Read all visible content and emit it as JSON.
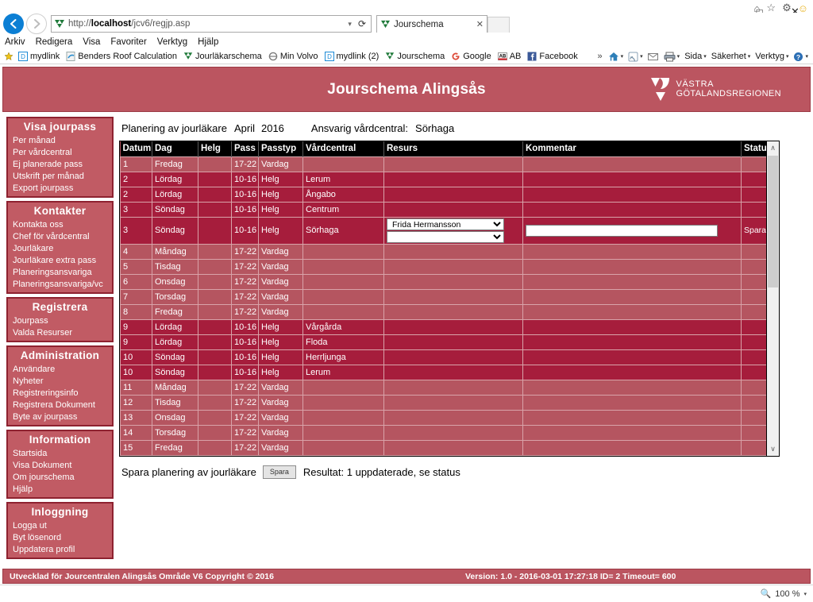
{
  "browser": {
    "window_controls": {
      "minimize": "–",
      "maximize": "□",
      "close": "✕"
    },
    "back_glyph": "←",
    "forward_glyph": "→",
    "address": {
      "url_prefix": "http://",
      "url_host": "localhost",
      "url_path": "/jcv6/regjp.asp",
      "dropdown_caret": "▾",
      "reload_glyph": "⟳"
    },
    "tab": {
      "title": "Jourschema",
      "close_glyph": "✕"
    },
    "chrome_icons": [
      "home-icon",
      "favorites-star-icon",
      "settings-gear-icon",
      "smiley-icon"
    ],
    "menu": [
      "Arkiv",
      "Redigera",
      "Visa",
      "Favoriter",
      "Verktyg",
      "Hjälp"
    ],
    "favorites": [
      {
        "label": "mydlink",
        "icon": "dlink-icon"
      },
      {
        "label": "Benders Roof Calculation",
        "icon": "ie-page-icon"
      },
      {
        "label": "Jourläkarschema",
        "icon": "vgr-icon"
      },
      {
        "label": "Min Volvo",
        "icon": "volvo-icon"
      },
      {
        "label": "mydlink (2)",
        "icon": "dlink-icon"
      },
      {
        "label": "Jourschema",
        "icon": "vgr-icon"
      },
      {
        "label": "Google",
        "icon": "google-icon"
      },
      {
        "label": "AB",
        "icon": "aftonbladet-icon"
      },
      {
        "label": "Facebook",
        "icon": "facebook-icon"
      }
    ],
    "command_bar": {
      "overflow": "»",
      "items": [
        "Sida",
        "Säkerhet",
        "Verktyg"
      ],
      "caret": "▾"
    },
    "status_bar": {
      "zoom": "100 %",
      "zoom_caret": "▾"
    }
  },
  "banner": {
    "title": "Jourschema Alingsås",
    "logo_line1": "VÄSTRA",
    "logo_line2": "GÖTALANDSREGIONEN"
  },
  "sidebar": {
    "groups": [
      {
        "title": "Visa jourpass",
        "items": [
          "Per månad",
          "Per vårdcentral",
          "Ej planerade pass",
          "Utskrift per månad",
          "Export jourpass"
        ]
      },
      {
        "title": "Kontakter",
        "items": [
          "Kontakta oss",
          "Chef för vårdcentral",
          "Jourläkare",
          "Jourläkare extra pass",
          "Planeringsansvariga",
          "Planeringsansvariga/vc"
        ]
      },
      {
        "title": "Registrera",
        "items": [
          "Jourpass",
          "Valda Resurser"
        ]
      },
      {
        "title": "Administration",
        "items": [
          "Användare",
          "Nyheter",
          "Registreringsinfo",
          "Registrera Dokument",
          "Byte av jourpass"
        ]
      },
      {
        "title": "Information",
        "items": [
          "Startsida",
          "Visa Dokument",
          "Om jourschema",
          "Hjälp"
        ]
      },
      {
        "title": "Inloggning",
        "items": [
          "Logga ut",
          "Byt lösenord",
          "Uppdatera profil"
        ]
      }
    ]
  },
  "main": {
    "heading": {
      "label": "Planering av jourläkare",
      "month": "April",
      "year": "2016",
      "responsible_label": "Ansvarig vårdcentral:",
      "responsible_value": "Sörhaga"
    },
    "table": {
      "columns": [
        "Datum",
        "Dag",
        "Helg",
        "Pass",
        "Passtyp",
        "Vårdcentral",
        "Resurs",
        "Kommentar",
        "Status"
      ],
      "rows": [
        {
          "datum": "1",
          "dag": "Fredag",
          "helg": "",
          "pass": "17-22",
          "passtyp": "Vardag",
          "vc": "",
          "kind": "vardag"
        },
        {
          "datum": "2",
          "dag": "Lördag",
          "helg": "",
          "pass": "10-16",
          "passtyp": "Helg",
          "vc": "Lerum",
          "kind": "helg"
        },
        {
          "datum": "2",
          "dag": "Lördag",
          "helg": "",
          "pass": "10-16",
          "passtyp": "Helg",
          "vc": "Ångabo",
          "kind": "helg"
        },
        {
          "datum": "3",
          "dag": "Söndag",
          "helg": "",
          "pass": "10-16",
          "passtyp": "Helg",
          "vc": "Centrum",
          "kind": "helg"
        },
        {
          "datum": "3",
          "dag": "Söndag",
          "helg": "",
          "pass": "10-16",
          "passtyp": "Helg",
          "vc": "Sörhaga",
          "kind": "selected",
          "resource_value": "Frida Hermansson",
          "resource_value2": "",
          "kommentar": "",
          "status": "Sparad"
        },
        {
          "datum": "4",
          "dag": "Måndag",
          "helg": "",
          "pass": "17-22",
          "passtyp": "Vardag",
          "vc": "",
          "kind": "vardag"
        },
        {
          "datum": "5",
          "dag": "Tisdag",
          "helg": "",
          "pass": "17-22",
          "passtyp": "Vardag",
          "vc": "",
          "kind": "vardag"
        },
        {
          "datum": "6",
          "dag": "Onsdag",
          "helg": "",
          "pass": "17-22",
          "passtyp": "Vardag",
          "vc": "",
          "kind": "vardag"
        },
        {
          "datum": "7",
          "dag": "Torsdag",
          "helg": "",
          "pass": "17-22",
          "passtyp": "Vardag",
          "vc": "",
          "kind": "vardag"
        },
        {
          "datum": "8",
          "dag": "Fredag",
          "helg": "",
          "pass": "17-22",
          "passtyp": "Vardag",
          "vc": "",
          "kind": "vardag"
        },
        {
          "datum": "9",
          "dag": "Lördag",
          "helg": "",
          "pass": "10-16",
          "passtyp": "Helg",
          "vc": "Vårgårda",
          "kind": "helg"
        },
        {
          "datum": "9",
          "dag": "Lördag",
          "helg": "",
          "pass": "10-16",
          "passtyp": "Helg",
          "vc": "Floda",
          "kind": "helg"
        },
        {
          "datum": "10",
          "dag": "Söndag",
          "helg": "",
          "pass": "10-16",
          "passtyp": "Helg",
          "vc": "Herrljunga",
          "kind": "helg"
        },
        {
          "datum": "10",
          "dag": "Söndag",
          "helg": "",
          "pass": "10-16",
          "passtyp": "Helg",
          "vc": "Lerum",
          "kind": "helg"
        },
        {
          "datum": "11",
          "dag": "Måndag",
          "helg": "",
          "pass": "17-22",
          "passtyp": "Vardag",
          "vc": "",
          "kind": "vardag"
        },
        {
          "datum": "12",
          "dag": "Tisdag",
          "helg": "",
          "pass": "17-22",
          "passtyp": "Vardag",
          "vc": "",
          "kind": "vardag"
        },
        {
          "datum": "13",
          "dag": "Onsdag",
          "helg": "",
          "pass": "17-22",
          "passtyp": "Vardag",
          "vc": "",
          "kind": "vardag"
        },
        {
          "datum": "14",
          "dag": "Torsdag",
          "helg": "",
          "pass": "17-22",
          "passtyp": "Vardag",
          "vc": "",
          "kind": "vardag"
        },
        {
          "datum": "15",
          "dag": "Fredag",
          "helg": "",
          "pass": "17-22",
          "passtyp": "Vardag",
          "vc": "",
          "kind": "vardag"
        }
      ],
      "scroll_up_glyph": "∧",
      "scroll_down_glyph": "∨"
    },
    "save_row": {
      "label": "Spara planering av jourläkare",
      "button": "Spara",
      "result": "Resultat: 1 uppdaterade, se status"
    }
  },
  "footer": {
    "left": "Utvecklad för Jourcentralen Alingsås Område V6 Copyright © 2016",
    "right": "Version: 1.0 - 2016-03-01 17:27:18 ID= 2 Timeout= 600"
  },
  "colors": {
    "brand_red": "#bb5560",
    "menu_red": "#c15b64",
    "menu_border": "#8e2230",
    "row_vardag": "#b55560",
    "row_helg": "#a61d3c",
    "header_black": "#000000"
  }
}
